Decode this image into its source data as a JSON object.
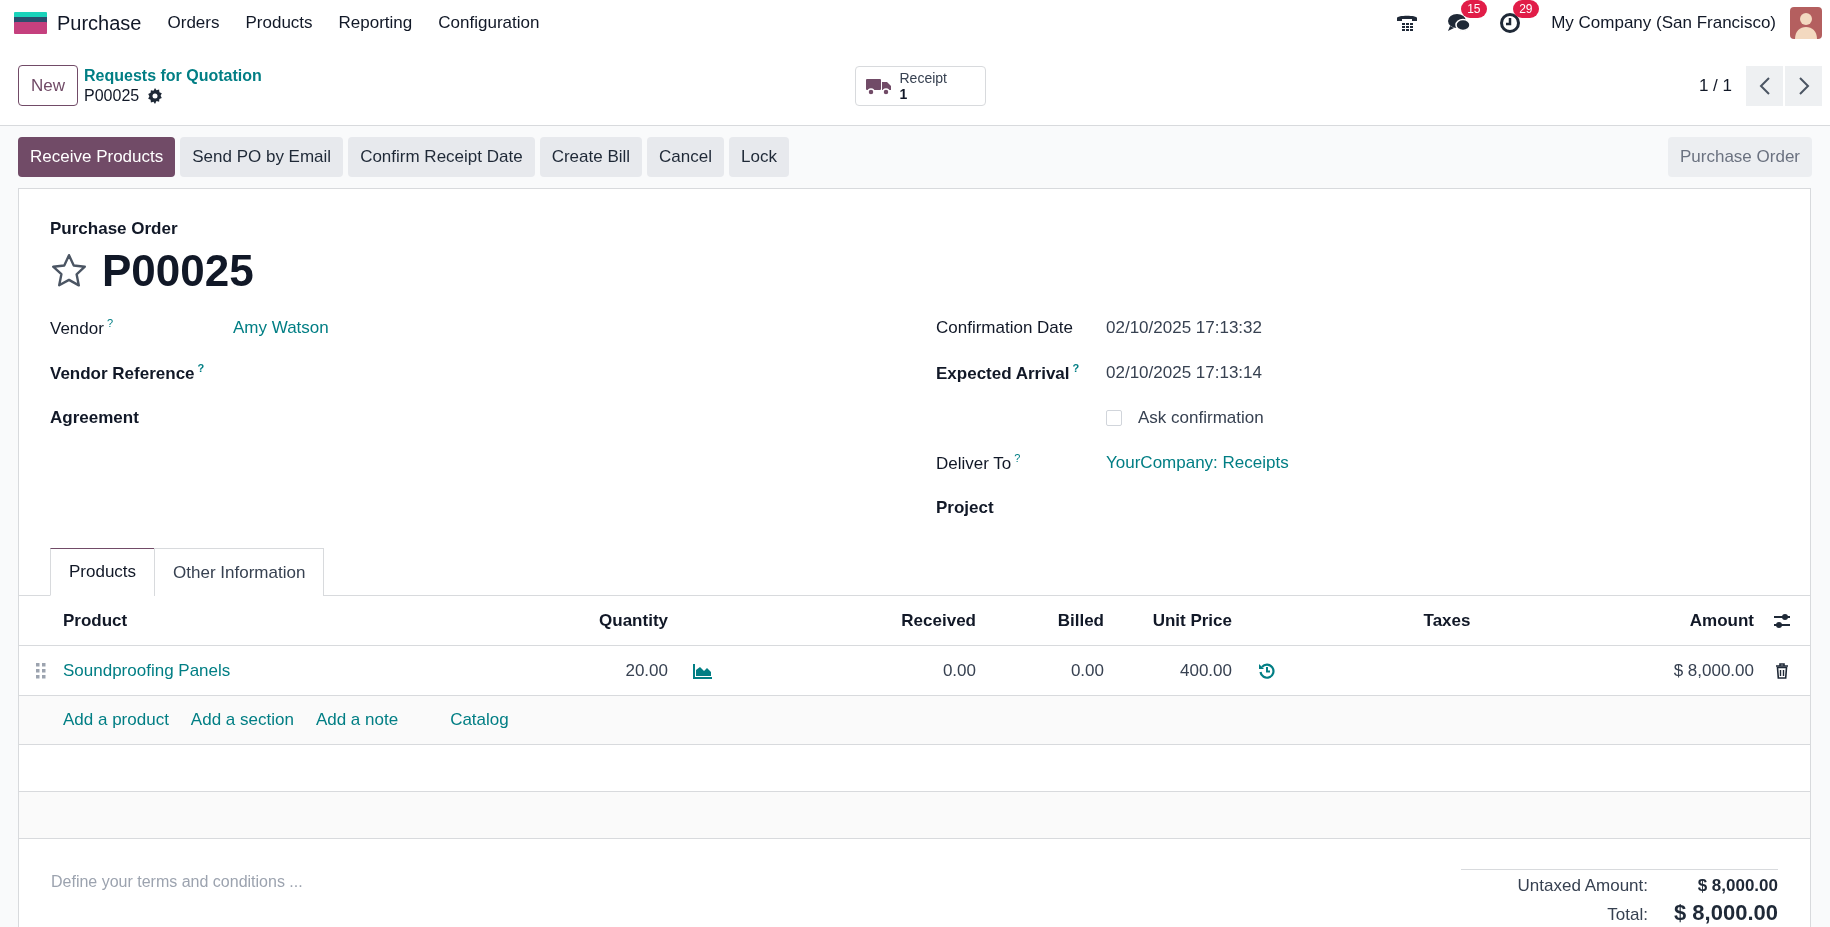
{
  "navbar": {
    "app_name": "Purchase",
    "menu": [
      "Orders",
      "Products",
      "Reporting",
      "Configuration"
    ],
    "systray": [
      {
        "kind": "phone"
      },
      {
        "kind": "messages",
        "badge": "15"
      },
      {
        "kind": "activities",
        "badge": "29"
      }
    ],
    "company": "My Company (San Francisco)"
  },
  "control_panel": {
    "new_button": "New",
    "breadcrumb": "Requests for Quotation",
    "record": "P00025",
    "smart_button": {
      "label": "Receipt",
      "value": "1"
    },
    "pager": "1 / 1"
  },
  "status_bar": {
    "buttons": [
      {
        "label": "Receive Products",
        "primary": true
      },
      {
        "label": "Send PO by Email",
        "primary": false
      },
      {
        "label": "Confirm Receipt Date",
        "primary": false
      },
      {
        "label": "Create Bill",
        "primary": false
      },
      {
        "label": "Cancel",
        "primary": false
      },
      {
        "label": "Lock",
        "primary": false
      }
    ],
    "stage": "Purchase Order"
  },
  "form": {
    "subtitle": "Purchase Order",
    "name": "P00025",
    "favorite": false,
    "left_fields": [
      {
        "kind": "field",
        "label": "Vendor",
        "bold": false,
        "help": "?",
        "value": "Amy Watson",
        "link": true
      },
      {
        "kind": "field",
        "label": "Vendor Reference",
        "bold": true,
        "help": "?"
      },
      {
        "kind": "field",
        "label": "Agreement",
        "bold": true
      }
    ],
    "right_fields": [
      {
        "kind": "field",
        "label": "Confirmation Date",
        "bold": false,
        "value": "02/10/2025 17:13:32",
        "link": false
      },
      {
        "kind": "field",
        "label": "Expected Arrival",
        "bold": true,
        "help": "?",
        "value": "02/10/2025 17:13:14",
        "link": false
      },
      {
        "kind": "checkbox",
        "label": "Ask confirmation",
        "checked": false
      },
      {
        "kind": "field",
        "label": "Deliver To",
        "bold": false,
        "help": "?",
        "value": "YourCompany: Receipts",
        "link": true
      },
      {
        "kind": "field",
        "label": "Project",
        "bold": true
      }
    ]
  },
  "tabs": [
    {
      "label": "Products",
      "selected": true
    },
    {
      "label": "Other Information",
      "selected": false
    }
  ],
  "order_lines": {
    "columns": [
      "Product",
      "Quantity",
      "Received",
      "Billed",
      "Unit Price",
      "Taxes",
      "Amount"
    ],
    "rows": [
      {
        "product": "Soundproofing Panels",
        "quantity": "20.00",
        "received": "0.00",
        "billed": "0.00",
        "unit_price": "400.00",
        "amount": "$ 8,000.00"
      }
    ],
    "add_links": [
      "Add a product",
      "Add a section",
      "Add a note",
      "Catalog"
    ]
  },
  "terms": {
    "placeholder": "Define your terms and conditions ..."
  },
  "totals": [
    {
      "kind": "subtotal",
      "label": "Untaxed Amount:",
      "value": "$ 8,000.00"
    },
    {
      "kind": "total",
      "label": "Total:",
      "value": "$ 8,000.00"
    }
  ]
}
